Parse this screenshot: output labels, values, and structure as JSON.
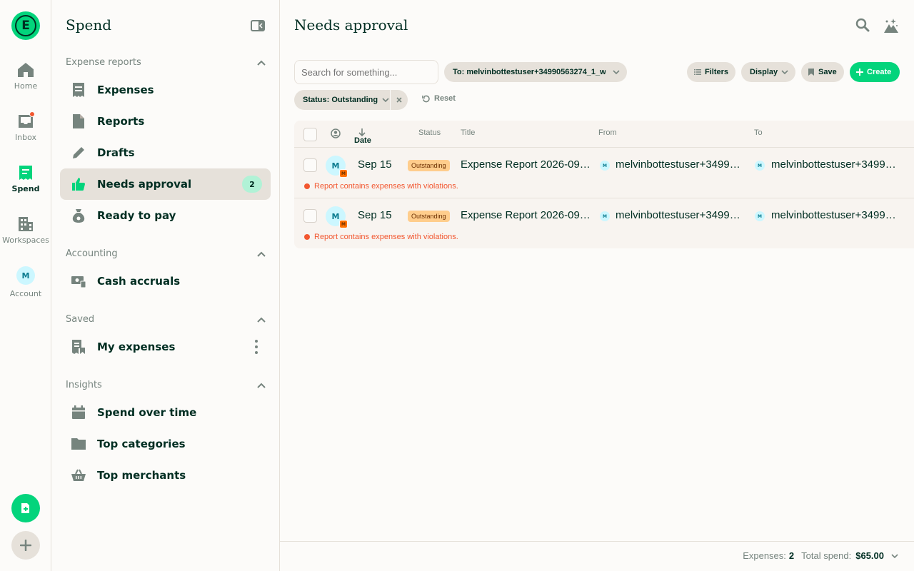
{
  "rail": {
    "items": [
      {
        "label": "Home",
        "icon": "home-icon"
      },
      {
        "label": "Inbox",
        "icon": "inbox-icon"
      },
      {
        "label": "Spend",
        "icon": "receipt-icon"
      },
      {
        "label": "Workspaces",
        "icon": "building-icon"
      },
      {
        "label": "Account",
        "icon": "avatar"
      }
    ],
    "avatar_initial": "M"
  },
  "sidebar": {
    "title": "Spend",
    "sections": [
      {
        "header": "Expense reports",
        "items": [
          {
            "label": "Expenses",
            "icon": "receipt-icon"
          },
          {
            "label": "Reports",
            "icon": "document-icon"
          },
          {
            "label": "Drafts",
            "icon": "pencil-icon"
          },
          {
            "label": "Needs approval",
            "icon": "thumbs-up-icon",
            "badge": "2"
          },
          {
            "label": "Ready to pay",
            "icon": "money-bag-icon"
          }
        ]
      },
      {
        "header": "Accounting",
        "items": [
          {
            "label": "Cash accruals",
            "icon": "cash-icon"
          }
        ]
      },
      {
        "header": "Saved",
        "items": [
          {
            "label": "My expenses",
            "icon": "receipt-bookmark-icon"
          }
        ]
      },
      {
        "header": "Insights",
        "items": [
          {
            "label": "Spend over time",
            "icon": "calendar-icon"
          },
          {
            "label": "Top categories",
            "icon": "folder-icon"
          },
          {
            "label": "Top merchants",
            "icon": "basket-icon"
          }
        ]
      }
    ]
  },
  "main": {
    "title": "Needs approval",
    "search": {
      "placeholder": "Search for something..."
    },
    "to_filter": "To: melvinbottestuser+34990563274_1_w...",
    "buttons": {
      "filters": "Filters",
      "display": "Display",
      "save": "Save",
      "create": "Create",
      "reset": "Reset"
    },
    "status_filter": "Status: Outstanding",
    "columns": {
      "date": "Date",
      "status": "Status",
      "title": "Title",
      "from": "From",
      "to": "To"
    },
    "rows": [
      {
        "initial": "M",
        "sub_initial": "M",
        "date": "Sep 15",
        "status": "Outstanding",
        "title": "Expense Report 2026-09-...",
        "from_initial": "M",
        "from": "melvinbottestuser+34990...",
        "to_initial": "M",
        "to": "melvinbottestuser+34990...",
        "violation": "Report contains expenses with violations."
      },
      {
        "initial": "M",
        "sub_initial": "M",
        "date": "Sep 15",
        "status": "Outstanding",
        "title": "Expense Report 2026-09-...",
        "from_initial": "M",
        "from": "melvinbottestuser+34990...",
        "to_initial": "M",
        "to": "melvinbottestuser+34990...",
        "violation": "Report contains expenses with violations."
      }
    ],
    "footer": {
      "expenses_label": "Expenses:",
      "expenses_count": "2",
      "total_label": "Total spend:",
      "total_value": "$65.00"
    }
  },
  "colors": {
    "brand_green": "#03d47c",
    "dark_text": "#002e22",
    "danger": "#f25730",
    "muted": "#76847e",
    "badge_bg": "#b1f2d6",
    "status_bg": "#ffcd8c"
  }
}
